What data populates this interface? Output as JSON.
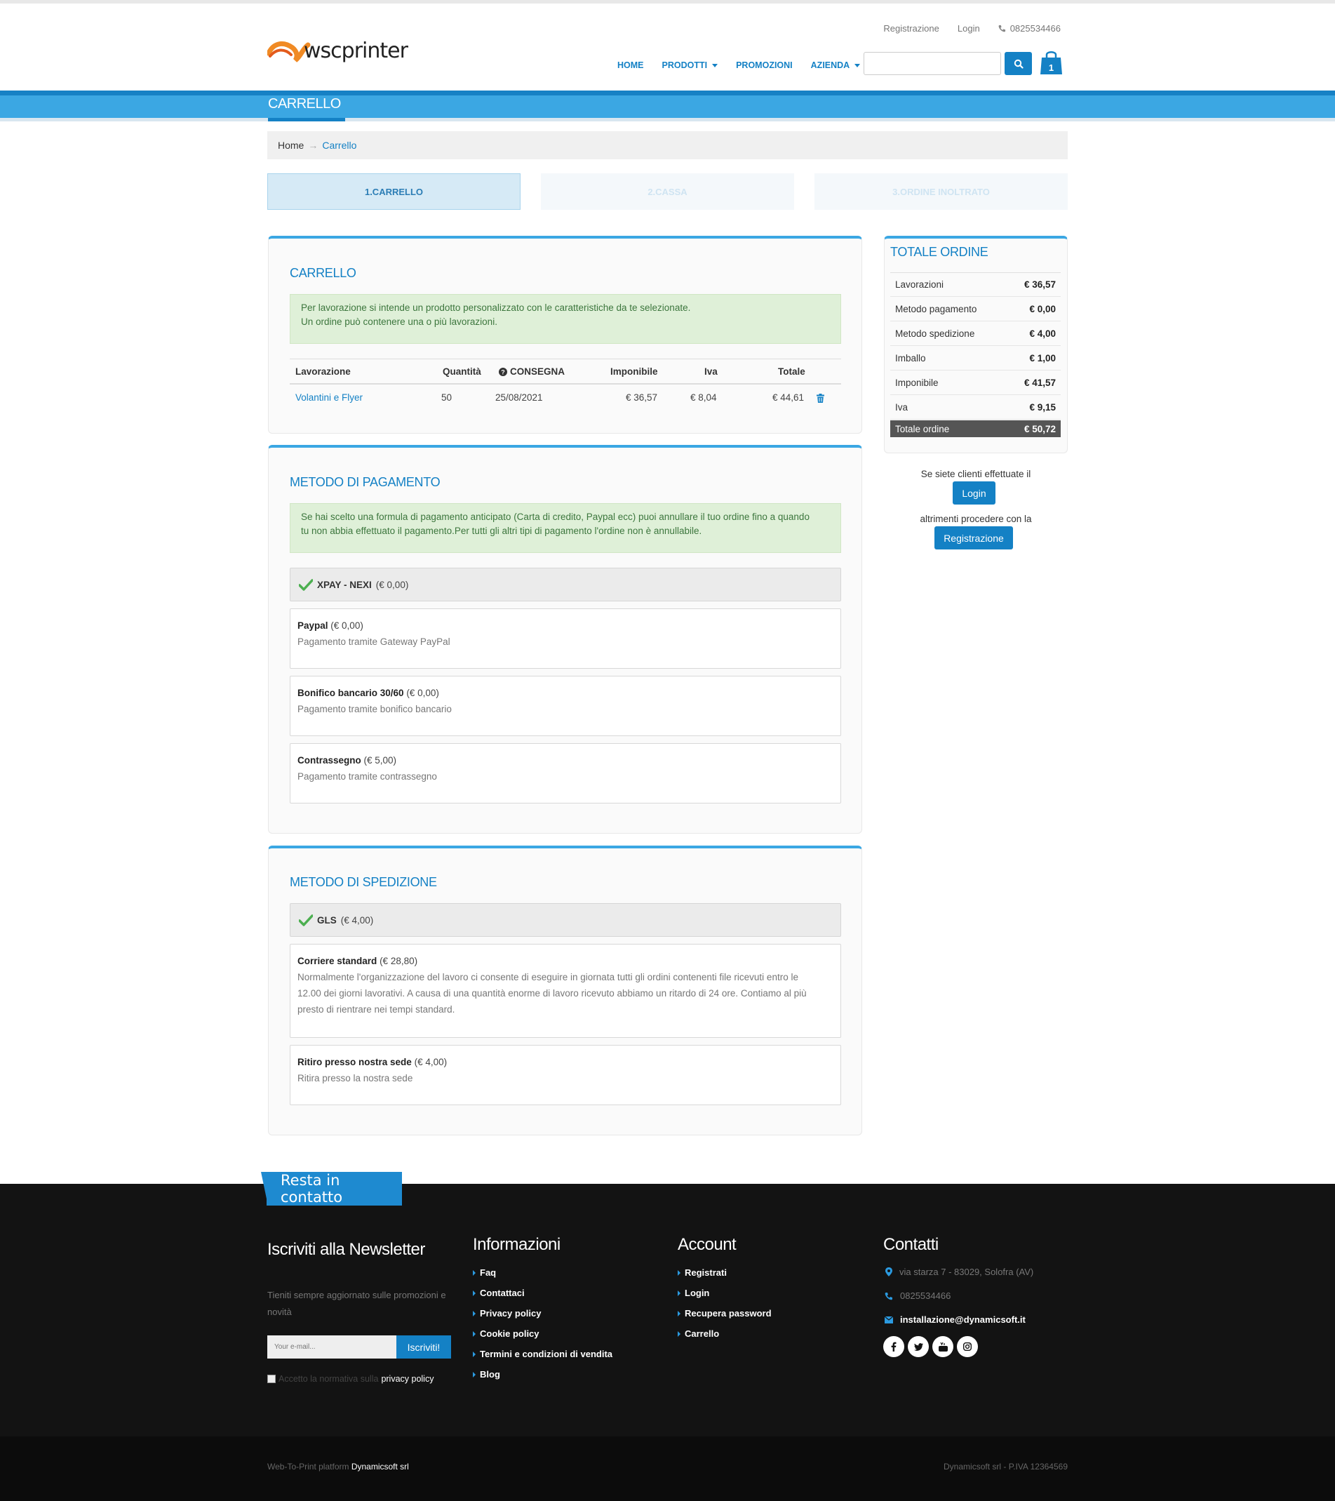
{
  "header": {
    "logo_text": "wscprinter",
    "top_links": {
      "register": "Registrazione",
      "login": "Login",
      "phone": "0825534466"
    },
    "nav": {
      "home": "HOME",
      "products": "PRODOTTI",
      "promotions": "PROMOZIONI",
      "company": "AZIENDA"
    },
    "search_placeholder": "",
    "cart_count": "1"
  },
  "page_title": "CARRELLO",
  "breadcrumb": {
    "home": "Home",
    "current": "Carrello"
  },
  "steps": {
    "cart": "1.CARRELLO",
    "checkout": "2.CASSA",
    "sent": "3.ORDINE INOLTRATO"
  },
  "cart": {
    "title": "CARRELLO",
    "notice_line1": "Per lavorazione si intende un prodotto personalizzato con le caratteristiche da te selezionate.",
    "notice_line2": "Un ordine può contenere una o più lavorazioni.",
    "columns": {
      "job": "Lavorazione",
      "qty": "Quantità",
      "delivery": "CONSEGNA",
      "taxable": "Imponibile",
      "vat": "Iva",
      "total": "Totale"
    },
    "rows": [
      {
        "job": "Volantini e Flyer",
        "qty": "50",
        "delivery": "25/08/2021",
        "taxable": "€ 36,57",
        "vat": "€ 8,04",
        "total": "€ 44,61"
      }
    ]
  },
  "payment": {
    "title": "METODO DI PAGAMENTO",
    "notice_line1": "Se hai scelto una formula di pagamento anticipato (Carta di credito, Paypal ecc) puoi annullare il tuo ordine fino a quando",
    "notice_line2": "tu non abbia effettuato il pagamento.Per tutti gli altri tipi di pagamento l'ordine non è annullabile.",
    "selected": {
      "name": "XPAY - NEXI",
      "price": "(€ 0,00)"
    },
    "options": [
      {
        "name": "Paypal",
        "price": "(€ 0,00)",
        "desc": "Pagamento tramite Gateway PayPal"
      },
      {
        "name": "Bonifico bancario 30/60",
        "price": "(€ 0,00)",
        "desc": "Pagamento tramite bonifico bancario"
      },
      {
        "name": "Contrassegno",
        "price": "(€ 5,00)",
        "desc": "Pagamento tramite contrassegno"
      }
    ]
  },
  "shipping": {
    "title": "METODO DI SPEDIZIONE",
    "selected": {
      "name": "GLS",
      "price": "(€ 4,00)"
    },
    "options": [
      {
        "name": "Corriere standard",
        "price": "(€ 28,80)",
        "desc_line1": "Normalmente l'organizzazione del lavoro ci consente di eseguire in giornata tutti gli ordini contenenti file ricevuti entro le",
        "desc_line2": "12.00 dei giorni lavorativi. A causa di una quantità enorme di lavoro ricevuto abbiamo un ritardo di 24 ore. Contiamo al più",
        "desc_line3": "presto di rientrare nei tempi standard."
      },
      {
        "name": "Ritiro presso nostra sede",
        "price": "(€ 4,00)",
        "desc": "Ritira presso la nostra sede"
      }
    ]
  },
  "summary": {
    "title": "TOTALE ORDINE",
    "rows": [
      {
        "label": "Lavorazioni",
        "value": "€ 36,57"
      },
      {
        "label": "Metodo pagamento",
        "value": "€ 0,00"
      },
      {
        "label": "Metodo spedizione",
        "value": "€ 4,00"
      },
      {
        "label": "Imballo",
        "value": "€ 1,00"
      },
      {
        "label": "Imponibile",
        "value": "€ 41,57"
      },
      {
        "label": "Iva",
        "value": "€ 9,15"
      }
    ],
    "total_label": "Totale ordine",
    "total_value": "€ 50,72",
    "client_text": "Se siete clienti effettuate il",
    "login_btn": "Login",
    "other_text": "altrimenti procedere con la",
    "register_btn": "Registrazione"
  },
  "footer": {
    "tab": "Resta in contatto",
    "newsletter": {
      "title": "Iscriviti alla Newsletter",
      "text_line1": "Tieniti sempre aggiornato sulle promozioni e",
      "text_line2": "novità",
      "placeholder": "Your e-mail...",
      "button": "Iscriviti!",
      "consent": "Accetto la normativa sulla",
      "consent_link": "privacy policy"
    },
    "info": {
      "title": "Informazioni",
      "links": [
        "Faq",
        "Contattaci",
        "Privacy policy",
        "Cookie policy",
        "Termini e condizioni di vendita",
        "Blog"
      ]
    },
    "account": {
      "title": "Account",
      "links": [
        "Registrati",
        "Login",
        "Recupera password",
        "Carrello"
      ]
    },
    "contacts": {
      "title": "Contatti",
      "address": "via starza 7 - 83029, Solofra (AV)",
      "phone": "0825534466",
      "email": "installazione@dynamicsoft.it"
    },
    "bottom_left": "Web-To-Print platform",
    "bottom_left_brand": "Dynamicsoft srl",
    "bottom_right": "Dynamicsoft srl - P.IVA 12364569"
  },
  "colors": {
    "accent": "#1481c5",
    "light_accent": "#3ba7e3",
    "success_bg": "#dff0d8",
    "footer_bg": "#131313"
  }
}
